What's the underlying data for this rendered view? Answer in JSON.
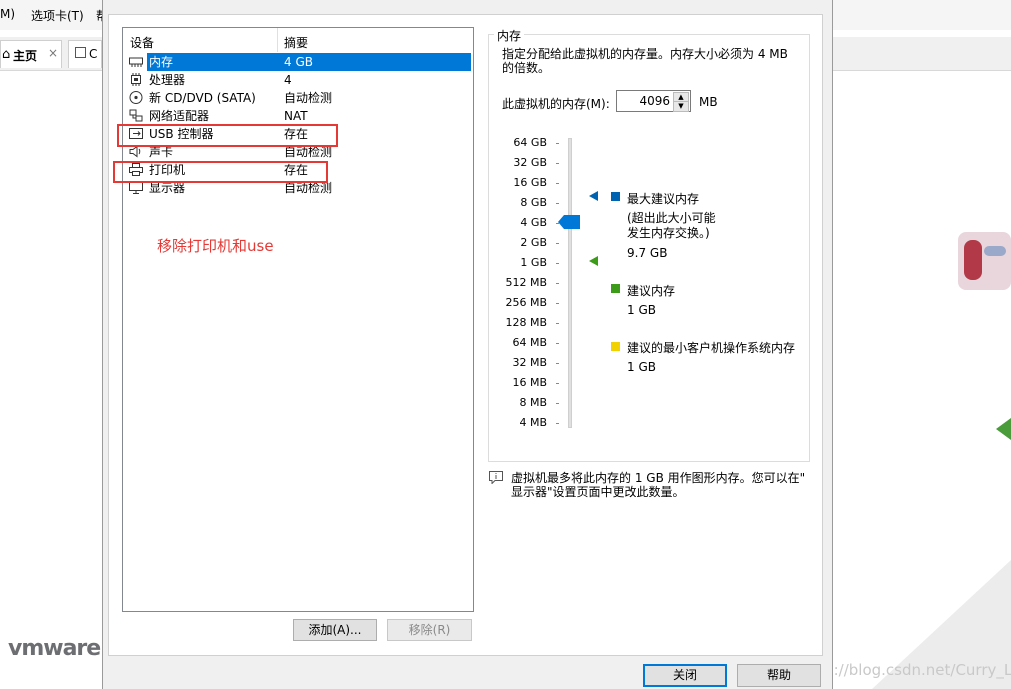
{
  "background_app": {
    "menu_items": [
      "M)",
      "选项卡(T)",
      "帮"
    ],
    "tabs": [
      {
        "label": "主页"
      },
      {
        "label": "C"
      }
    ],
    "brand": "vmware",
    "watermark": "https://blog.csdn.net/Curry_Li"
  },
  "device_list": {
    "header_device": "设备",
    "header_summary": "摘要",
    "rows": [
      {
        "icon": "memory-icon",
        "name": "内存",
        "summary": "4 GB",
        "selected": true
      },
      {
        "icon": "cpu-icon",
        "name": "处理器",
        "summary": "4"
      },
      {
        "icon": "cd-dvd-icon",
        "name": "新 CD/DVD (SATA)",
        "summary": "自动检测"
      },
      {
        "icon": "network-icon",
        "name": "网络适配器",
        "summary": "NAT"
      },
      {
        "icon": "usb-icon",
        "name": "USB 控制器",
        "summary": "存在"
      },
      {
        "icon": "sound-icon",
        "name": "声卡",
        "summary": "自动检测"
      },
      {
        "icon": "printer-icon",
        "name": "打印机",
        "summary": "存在"
      },
      {
        "icon": "display-icon",
        "name": "显示器",
        "summary": "自动检测"
      }
    ],
    "annotation": "移除打印机和use",
    "add_button": "添加(A)...",
    "remove_button": "移除(R)"
  },
  "memory": {
    "group_title": "内存",
    "description": "指定分配给此虚拟机的内存量。内存大小必须为 4 MB 的倍数。",
    "field_label": "此虚拟机的内存(M):",
    "value": "4096",
    "unit": "MB",
    "scale_labels": [
      "64 GB",
      "32 GB",
      "16 GB",
      "8 GB",
      "4 GB",
      "2 GB",
      "1 GB",
      "512 MB",
      "256 MB",
      "128 MB",
      "64 MB",
      "32 MB",
      "16 MB",
      "8 MB",
      "4 MB"
    ],
    "current_index": 4,
    "legend": [
      {
        "label": "最大建议内存",
        "note": "(超出此大小可能发生内存交换。)",
        "value": "9.7 GB",
        "color": "#0063b1"
      },
      {
        "label": "建议内存",
        "value": "1 GB",
        "color": "#3c9b19"
      },
      {
        "label": "建议的最小客户机操作系统内存",
        "value": "1 GB",
        "color": "#f2d100"
      }
    ],
    "info_text_line1": "虚拟机最多将此内存的 1 GB 用作图形内存。您可以在\"",
    "info_text_line2": "显示器\"设置页面中更改此数量。"
  },
  "footer": {
    "close_button": "关闭",
    "help_button": "帮助"
  }
}
